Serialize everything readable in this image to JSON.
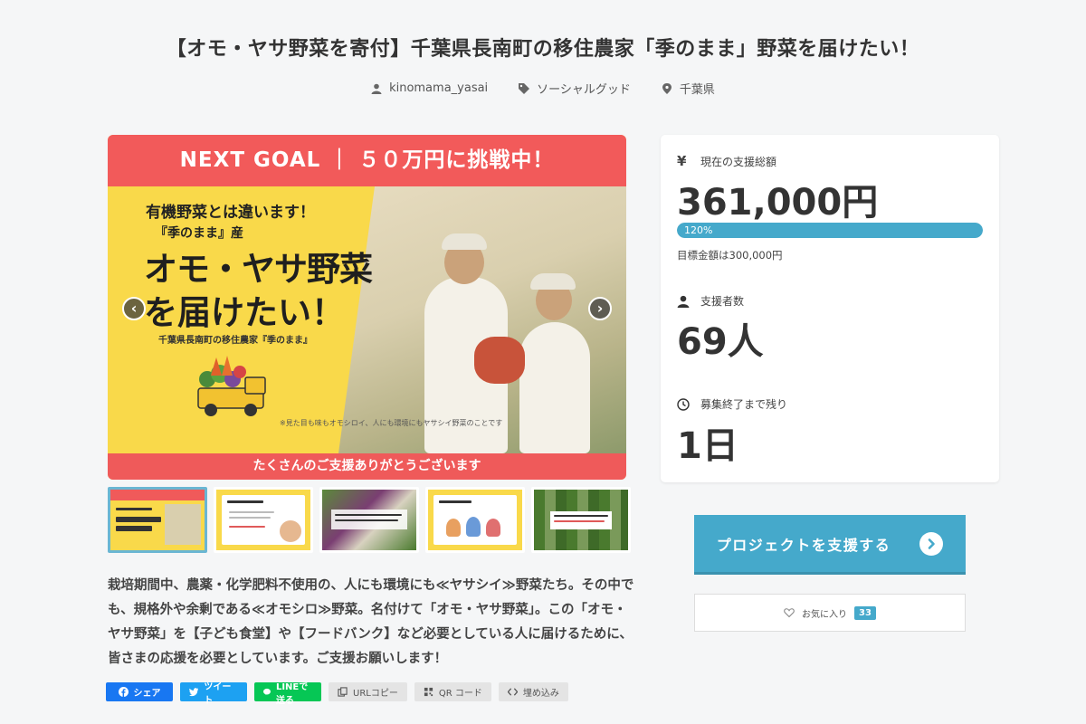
{
  "project": {
    "title": "【オモ・ヤサ野菜を寄付】千葉県長南町の移住農家「季のまま」野菜を届けたい！",
    "owner": "kinomama_yasai",
    "category": "ソーシャルグッド",
    "location": "千葉県"
  },
  "main_image": {
    "banner": "NEXT GOAL ｜ ５０万円に挑戦中！",
    "line1": "有機野菜とは違います！",
    "line2": "『季のまま』産",
    "line3": "オモ・ヤサ野菜",
    "line4": "を届けたい！",
    "line5": "千葉県長南町の移住農家『季のまま』",
    "note": "※見た目も味もオモシロイ、人にも環境にもヤサシイ野菜のことです",
    "footer": "たくさんのご支援ありがとうございます",
    "prev_arrow": "‹",
    "next_arrow": "›"
  },
  "description": "栽培期間中、農薬・化学肥料不使用の、人にも環境にも≪ヤサシイ≫野菜たち。その中でも、規格外や余剰である≪オモシロ≫野菜。名付けて「オモ・ヤサ野菜」。この「オモ・ヤサ野菜」を【子ども食堂】や【フードバンク】など必要としている人に届けるために、皆さまの応援を必要としています。ご支援お願いします！",
  "share": {
    "facebook": "シェア",
    "twitter": "ツイート",
    "line": "LINEで送る",
    "url_copy": "URLコピー",
    "qr": "QR コード",
    "embed": "埋め込み"
  },
  "stats": {
    "total_label": "現在の支援総額",
    "total_value": "361,000円",
    "progress_text": "120%",
    "progress_ratio": 1.2,
    "goal_text": "目標金額は300,000円",
    "backers_label": "支援者数",
    "backers_value": "69人",
    "remaining_label": "募集終了まで残り",
    "remaining_value": "1日"
  },
  "actions": {
    "support": "プロジェクトを支援する",
    "favorite": "お気に入り",
    "favorite_count": "33"
  },
  "colors": {
    "accent": "#45a9cb",
    "banner_red": "#f25a5a",
    "yellow": "#f9d94a"
  }
}
